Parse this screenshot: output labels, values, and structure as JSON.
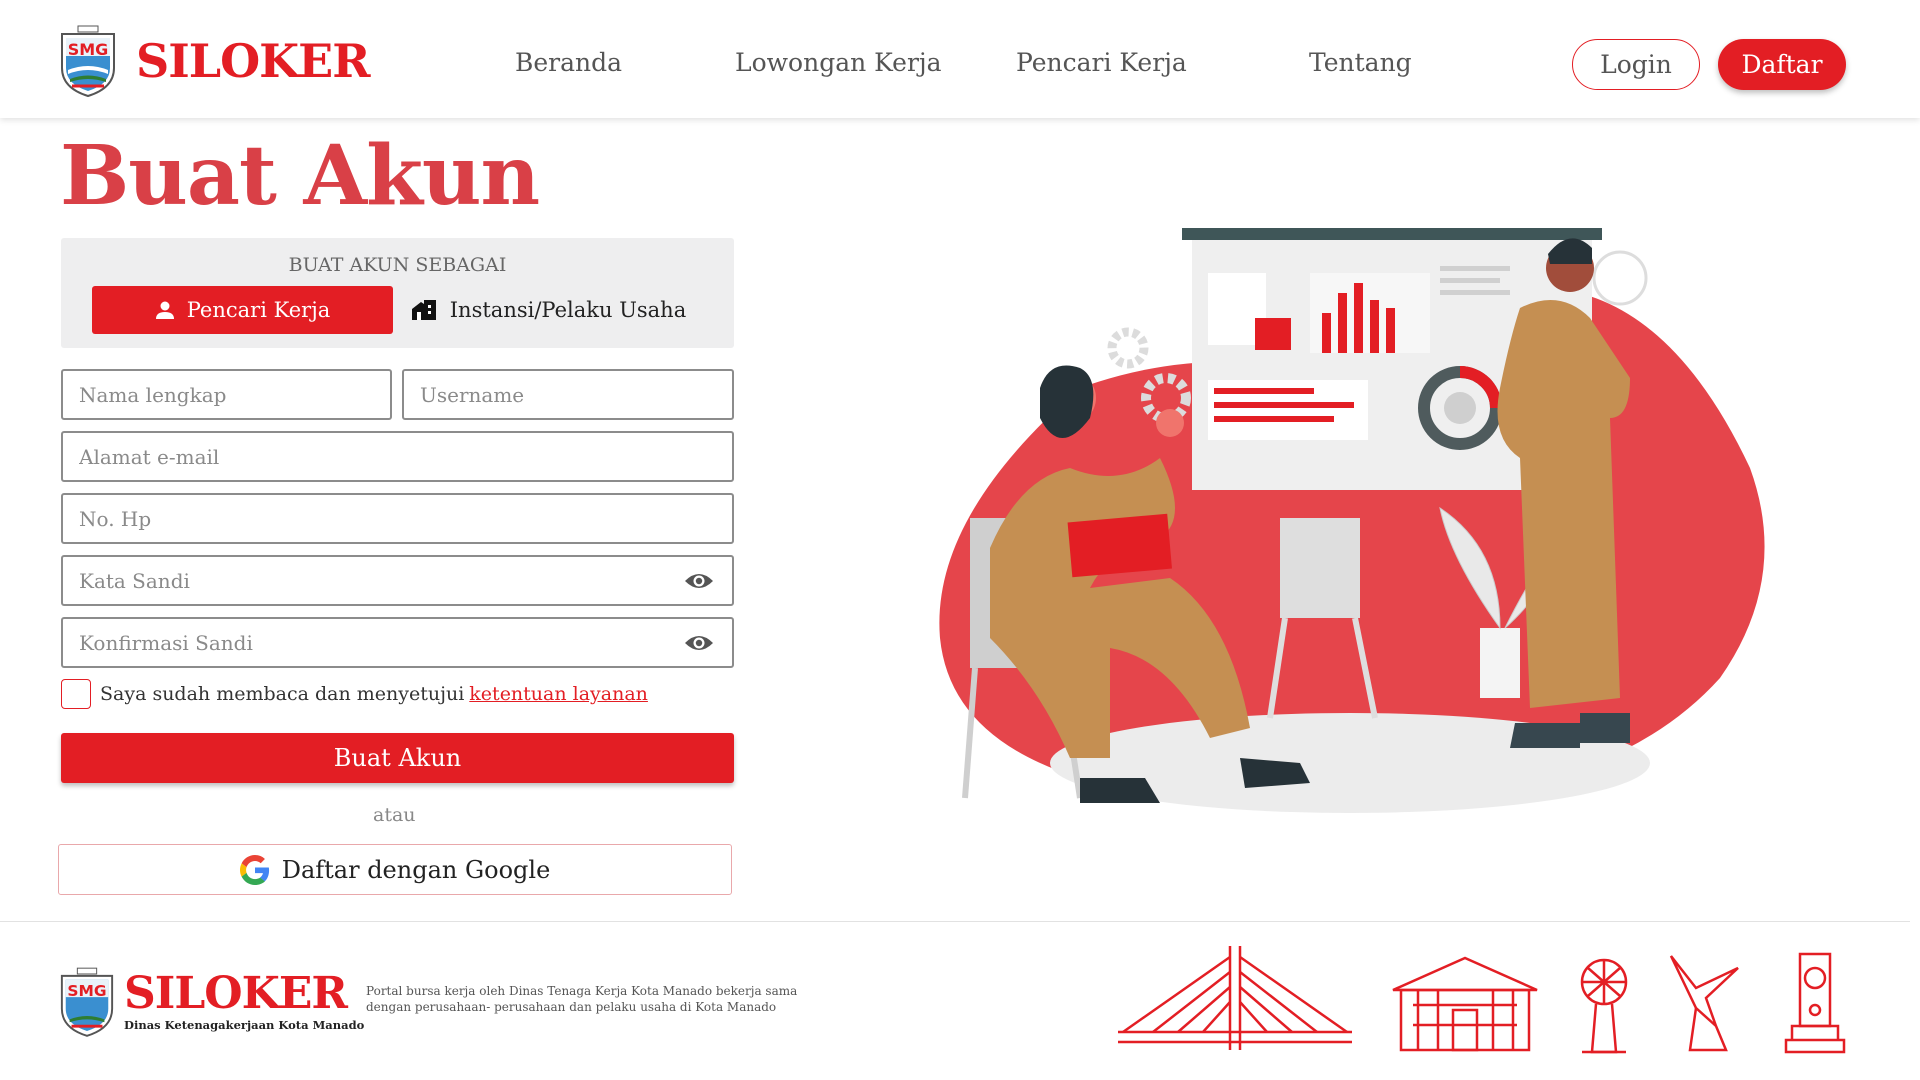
{
  "colors": {
    "accent": "#e31e24",
    "title": "#d94047",
    "text": "#555555"
  },
  "header": {
    "brand": "SILOKER",
    "nav": [
      "Beranda",
      "Lowongan Kerja",
      "Pencari Kerja",
      "Tentang"
    ],
    "login_label": "Login",
    "register_label": "Daftar"
  },
  "form": {
    "title": "Buat Akun",
    "role_caption": "BUAT AKUN SEBAGAI",
    "roles": [
      {
        "label": "Pencari Kerja",
        "icon": "user-icon",
        "selected": true
      },
      {
        "label": "Instansi/Pelaku Usaha",
        "icon": "building-icon",
        "selected": false
      }
    ],
    "fields": {
      "full_name": {
        "placeholder": "Nama lengkap",
        "value": ""
      },
      "username": {
        "placeholder": "Username",
        "value": ""
      },
      "email": {
        "placeholder": "Alamat e-mail",
        "value": ""
      },
      "phone": {
        "placeholder": "No. Hp",
        "value": ""
      },
      "password": {
        "placeholder": "Kata Sandi",
        "value": ""
      },
      "confirm_password": {
        "placeholder": "Konfirmasi Sandi",
        "value": ""
      }
    },
    "agree_text": "Saya sudah membaca dan menyetujui",
    "agree_link": "ketentuan layanan",
    "submit_label": "Buat Akun",
    "or_label": "atau",
    "google_label": "Daftar dengan Google"
  },
  "footer": {
    "brand": "SILOKER",
    "subtitle": "Dinas Ketenagakerjaan Kota Manado",
    "description": "Portal bursa kerja oleh Dinas Tenaga Kerja Kota Manado bekerja sama dengan perusahaan- perusahaan dan pelaku usaha di Kota Manado",
    "landmark_icons": [
      "bridge-icon",
      "building-icon",
      "monument-globe-icon",
      "statue-icon",
      "tower-monument-icon"
    ]
  }
}
